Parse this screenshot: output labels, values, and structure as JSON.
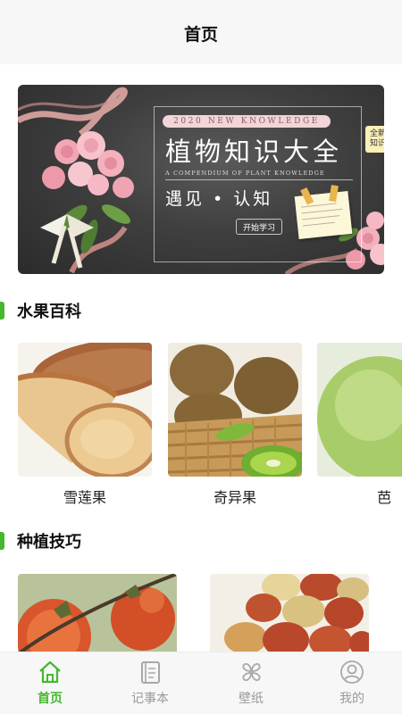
{
  "header": {
    "title": "首页"
  },
  "banner": {
    "eyebrow": "2020 NEW KNOWLEDGE",
    "title": "植物知识大全",
    "subtitle_en": "A COMPENDIUM OF PLANT KNOWLEDGE",
    "slogan": "遇见 • 认知",
    "cta": "开始学习",
    "badge_line1": "全新",
    "badge_line2": "知识"
  },
  "sections": {
    "fruits": {
      "title": "水果百科",
      "items": [
        {
          "name": "雪莲果"
        },
        {
          "name": "奇异果"
        },
        {
          "name": "芭"
        }
      ]
    },
    "planting": {
      "title": "种植技巧"
    }
  },
  "tabbar": {
    "items": [
      {
        "label": "首页",
        "icon": "home-icon",
        "active": true
      },
      {
        "label": "记事本",
        "icon": "notebook-icon",
        "active": false
      },
      {
        "label": "壁纸",
        "icon": "wallpaper-icon",
        "active": false
      },
      {
        "label": "我的",
        "icon": "profile-icon",
        "active": false
      }
    ],
    "active_color": "#44b82f",
    "inactive_color": "#9a9a9a"
  },
  "accent_color": "#44b82f"
}
